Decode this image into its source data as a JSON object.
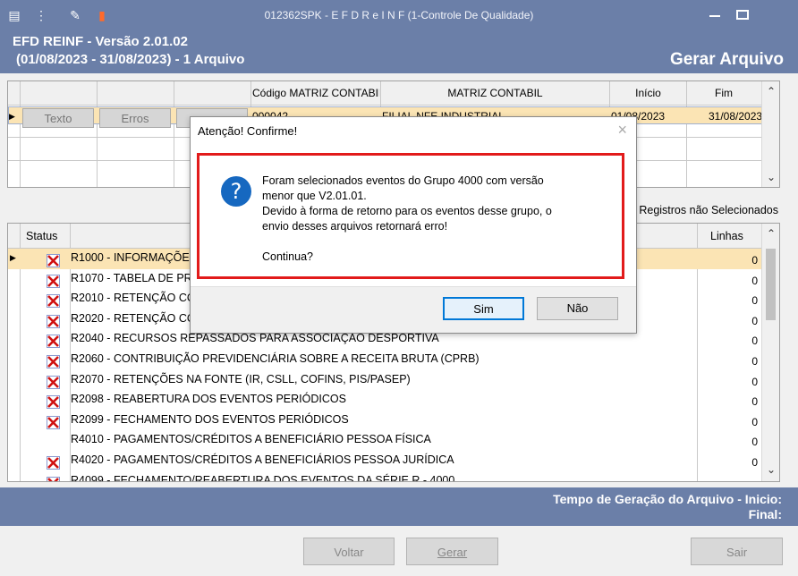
{
  "window": {
    "title": "012362SPK - E F D   R e I N F (1-Controle De Qualidade)"
  },
  "header": {
    "line1": "EFD REINF - Versão 2.01.02",
    "line2": "(01/08/2023 - 31/08/2023) - 1 Arquivo",
    "action": "Gerar Arquivo"
  },
  "grid1": {
    "columns": [
      "",
      "",
      "",
      "Código MATRIZ CONTABIL",
      "MATRIZ CONTABIL",
      "Início",
      "Fim"
    ],
    "row": {
      "codigo": "000042",
      "matriz": "FILIAL NFE INDUSTRIAL",
      "inicio": "01/08/2023",
      "fim": "31/08/2023"
    },
    "buttons": [
      "Texto",
      "Erros"
    ]
  },
  "registros_note": "Registros não Selecionados",
  "grid2": {
    "columns": {
      "status": "Status",
      "linhas": "Linhas"
    },
    "rows": [
      {
        "desc": "R1000 - INFORMAÇÕES DO CONTRIBUINTE",
        "linhas": "0",
        "status": "error"
      },
      {
        "desc": "R1070 - TABELA DE PROCESSOS ADMINISTRATIVOS/JUDICIAIS",
        "linhas": "0",
        "status": "error"
      },
      {
        "desc": "R2010 - RETENÇÃO CONTRIBUIÇÃO PREVIDENCIÁRIA - SERVIÇOS TOMADOS",
        "linhas": "0",
        "status": "error"
      },
      {
        "desc": "R2020 - RETENÇÃO CONTRIBUIÇÃO PREVIDENCIÁRIA - SERVIÇOS PRESTADOS",
        "linhas": "0",
        "status": "error"
      },
      {
        "desc": "R2040 - RECURSOS REPASSADOS PARA ASSOCIAÇÃO DESPORTIVA",
        "linhas": "0",
        "status": "error"
      },
      {
        "desc": "R2060 - CONTRIBUIÇÃO PREVIDENCIÁRIA SOBRE A RECEITA BRUTA (CPRB)",
        "linhas": "0",
        "status": "error"
      },
      {
        "desc": "R2070 - RETENÇÕES NA FONTE (IR, CSLL, COFINS, PIS/PASEP)",
        "linhas": "0",
        "status": "error"
      },
      {
        "desc": "R2098 - REABERTURA DOS EVENTOS PERIÓDICOS",
        "linhas": "0",
        "status": "error"
      },
      {
        "desc": "R2099 - FECHAMENTO DOS EVENTOS PERIÓDICOS",
        "linhas": "0",
        "status": "error"
      },
      {
        "desc": "R4010 - PAGAMENTOS/CRÉDITOS A BENEFICIÁRIO PESSOA FÍSICA",
        "linhas": "0",
        "status": "none"
      },
      {
        "desc": "R4020 - PAGAMENTOS/CRÉDITOS A BENEFICIÁRIOS PESSOA JURÍDICA",
        "linhas": "0",
        "status": "error"
      },
      {
        "desc": "R4099 - FECHAMENTO/REABERTURA DOS EVENTOS DA SÉRIE R - 4000",
        "linhas": "",
        "status": "error"
      }
    ]
  },
  "footer": {
    "line1": "Tempo de Geração do Arquivo - Inicio:",
    "line2": "Final:"
  },
  "buttons": {
    "voltar": "Voltar",
    "gerar": "Gerar",
    "sair": "Sair"
  },
  "dialog": {
    "title": "Atenção! Confirme!",
    "close": "×",
    "icon": "?",
    "message": [
      "Foram selecionados eventos do Grupo 4000 com versão",
      "menor que V2.01.01.",
      "Devido à forma de retorno para os eventos desse grupo, o",
      "envio desses arquivos retornará erro!",
      "",
      "Continua?"
    ],
    "yes": "Sim",
    "no": "Não"
  },
  "colors": {
    "header_bg": "#6b7fa8",
    "selected_row": "#fbe4b4",
    "alert_border": "#e21b1b",
    "question_icon": "#1668c0"
  },
  "icons": [
    "menu-icon",
    "traffic-light-icon",
    "wrench-icon",
    "book-icon",
    "minimize-icon",
    "restore-icon",
    "error-x-icon",
    "question-icon"
  ]
}
